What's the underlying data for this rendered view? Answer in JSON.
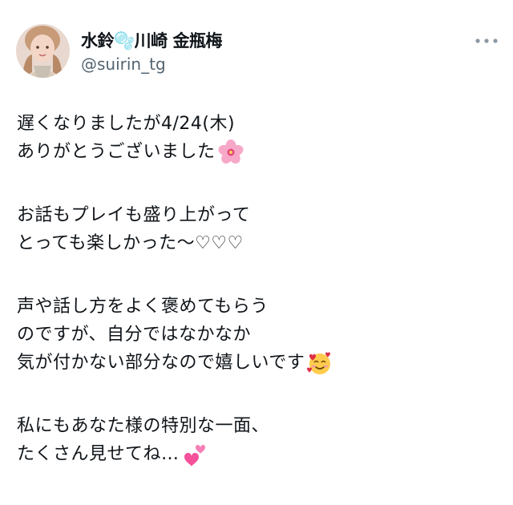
{
  "author": {
    "display_name": "水鈴🫧川崎 金瓶梅",
    "handle": "@suirin_tg",
    "avatar_icon": "user-avatar-photo"
  },
  "more_icon": "more-horizontal-icon",
  "tweet": {
    "paragraphs": [
      [
        "遅くなりましたが4/24(木)",
        "ありがとうございました"
      ],
      [
        "お話もプレイも盛り上がって",
        "とっても楽しかった〜♡♡♡"
      ],
      [
        "声や話し方をよく褒めてもらう",
        "のですが、自分ではなかなか",
        "気が付かない部分なので嬉しいです"
      ],
      [
        "私にもあなた様の特別な一面、",
        "たくさん見せてね…"
      ]
    ],
    "emojis": {
      "cherry_blossom": "cherry-blossom-icon",
      "smiling_hearts": "smiling-face-with-hearts-icon",
      "two_hearts": "two-hearts-icon"
    }
  },
  "colors": {
    "text": "#0f1419",
    "secondary": "#536471",
    "background": "#ffffff"
  }
}
